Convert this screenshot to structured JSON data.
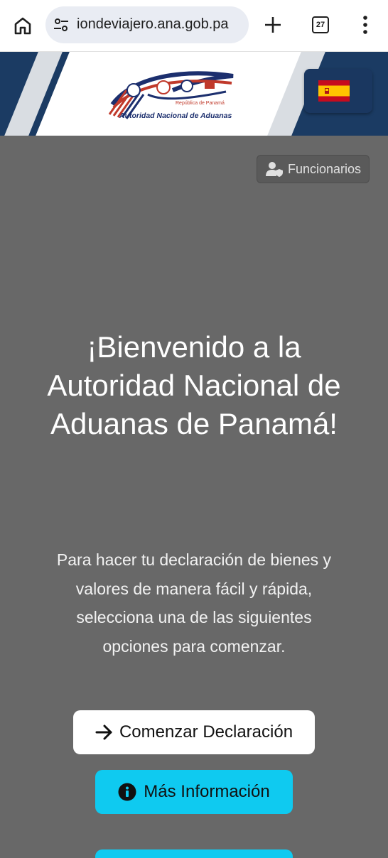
{
  "browser": {
    "url_text": "iondeviajero.ana.gob.pa",
    "tab_count": "27",
    "icons": [
      "home-icon",
      "site-settings-icon",
      "new-tab-icon",
      "tab-switcher-icon",
      "overflow-menu-icon"
    ]
  },
  "header": {
    "logo_subtitle": "República de Panamá",
    "logo_title": "Autoridad Nacional de Aduanas",
    "language_flag": "spain-flag-icon",
    "colors": {
      "header_bg": "#1b3b63",
      "accent_stripe": "#d9dde2"
    }
  },
  "hero": {
    "staff_button_label": "Funcionarios",
    "title": "¡Bienvenido a la Autoridad Nacional de Aduanas de Panamá!",
    "description": "Para hacer tu declaración de bienes y valores de manera fácil y rápida, selecciona una de las siguientes opciones para comenzar.",
    "start_button_label": "Comenzar Declaración",
    "info_button_label": "Más Información",
    "colors": {
      "background": "#686868",
      "info_button": "#0fcaf0",
      "start_button": "#ffffff"
    }
  }
}
